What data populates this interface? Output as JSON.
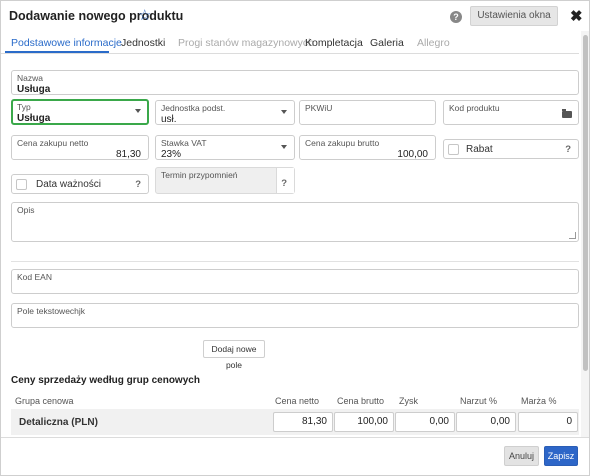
{
  "dialog": {
    "title": "Dodawanie nowego produktu",
    "settings_button": "Ustawienia okna",
    "help_symbol": "?",
    "close_symbol": "✖",
    "star_symbol": "☆"
  },
  "tabs": [
    {
      "label": "Podstawowe informacje",
      "state": "active"
    },
    {
      "label": "Jednostki",
      "state": "normal"
    },
    {
      "label": "Progi stanów magazynowych",
      "state": "disabled"
    },
    {
      "label": "Kompletacja",
      "state": "normal"
    },
    {
      "label": "Galeria",
      "state": "normal"
    },
    {
      "label": "Allegro",
      "state": "disabled"
    }
  ],
  "form": {
    "nazwa": {
      "label": "Nazwa",
      "value": "Usługa"
    },
    "typ": {
      "label": "Typ",
      "value": "Usługa"
    },
    "jednostka": {
      "label": "Jednostka podst.",
      "value": "usł."
    },
    "pkwiu": {
      "label": "PKWiU",
      "value": ""
    },
    "kod_produktu": {
      "label": "Kod produktu",
      "value": ""
    },
    "cena_netto": {
      "label": "Cena zakupu netto",
      "value": "81,30"
    },
    "stawka_vat": {
      "label": "Stawka VAT",
      "value": "23%"
    },
    "cena_brutto": {
      "label": "Cena zakupu brutto",
      "value": "100,00"
    },
    "rabat": {
      "label": "Rabat",
      "help": "?"
    },
    "data_waznosci": {
      "label": "Data ważności",
      "help": "?"
    },
    "termin": {
      "label": "Termin przypomnień",
      "help": "?"
    },
    "opis": {
      "label": "Opis",
      "value": ""
    },
    "kod_ean": {
      "label": "Kod EAN",
      "value": ""
    },
    "pole_tekstowe": {
      "label": "Pole tekstowechjk",
      "value": ""
    },
    "add_field_button": "Dodaj nowe pole"
  },
  "prices": {
    "section_title": "Ceny sprzedaży według grup cenowych",
    "headers": [
      "Grupa cenowa",
      "Cena netto",
      "Cena brutto",
      "Zysk",
      "Narzut %",
      "Marża %"
    ],
    "rows": [
      {
        "group": "Detaliczna (PLN)",
        "netto": "81,30",
        "brutto": "100,00",
        "zysk": "0,00",
        "narzut": "0,00",
        "marza": "0"
      }
    ]
  },
  "footer": {
    "cancel": "Anuluj",
    "save": "Zapisz"
  },
  "colors": {
    "accent": "#2a6bc9",
    "focus_border": "#3aa84a",
    "save_button": "#2d66c8"
  }
}
